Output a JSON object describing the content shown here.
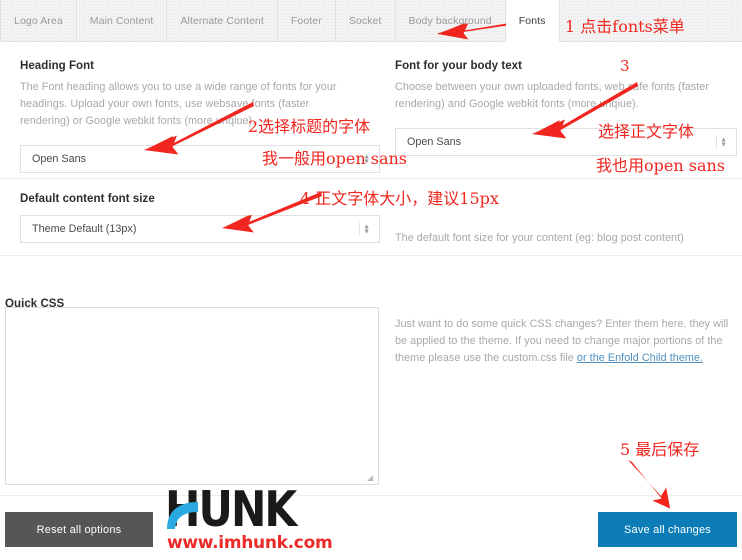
{
  "tabs": [
    {
      "label": "Logo Area",
      "active": false
    },
    {
      "label": "Main Content",
      "active": false
    },
    {
      "label": "Alternate Content",
      "active": false
    },
    {
      "label": "Footer",
      "active": false
    },
    {
      "label": "Socket",
      "active": false
    },
    {
      "label": "Body background",
      "active": false
    },
    {
      "label": "Fonts",
      "active": true
    }
  ],
  "heading_font": {
    "title": "Heading Font",
    "description": "The Font heading allows you to use a wide range of fonts for your headings. Upload your own fonts, use websave fonts (faster rendering) or Google webkit fonts (more unqiue).",
    "value": "Open Sans"
  },
  "body_font": {
    "title": "Font for your body text",
    "description": "Choose between your own uploaded fonts, web safe fonts (faster rendering) and Google webkit fonts (more unqiue).",
    "value": "Open Sans"
  },
  "content_font_size": {
    "title": "Default content font size",
    "value": "Theme Default (13px)",
    "description": "The default font size for your content (eg: blog post content)"
  },
  "quick_css": {
    "title": "Quick CSS",
    "value": "",
    "description_before": "Just want to do some quick CSS changes? Enter them here, they will be applied to the theme. If you need to change major portions of the theme please use the custom.css file ",
    "link_text": "or the Enfold Child theme.",
    "link_color": "#4e8fc0"
  },
  "footer": {
    "reset_label": "Reset all options",
    "save_label": "Save all changes",
    "reset_color": "#565656",
    "save_color": "#0b7cb5"
  },
  "watermark": {
    "brand": "HUNK",
    "url": "www.imhunk.com",
    "brand_color": "#1a1a1a",
    "url_color": "#ec2a28",
    "swoosh_color": "#29a9e0"
  },
  "annotations": {
    "color": "#f0261f",
    "items": [
      {
        "id": "a1",
        "text": "1 点击fonts菜单"
      },
      {
        "id": "a2",
        "text": "2选择标题的字体"
      },
      {
        "id": "a2b",
        "text": "我一般用open sans"
      },
      {
        "id": "a3",
        "text": "3"
      },
      {
        "id": "a3b",
        "text": "选择正文字体"
      },
      {
        "id": "a3c",
        "text": "我也用open sans"
      },
      {
        "id": "a4",
        "text": "4  正文字体大小，建议15px"
      },
      {
        "id": "a5",
        "text": "5 最后保存"
      }
    ]
  }
}
